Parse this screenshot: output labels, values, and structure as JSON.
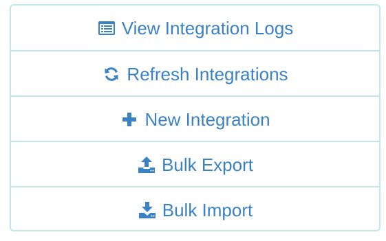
{
  "colors": {
    "accent": "#3b82c4",
    "border": "#bfe7ee",
    "background": "#ffffff"
  },
  "actions": [
    {
      "label": "View Integration Logs",
      "icon": "list-alt-icon"
    },
    {
      "label": "Refresh Integrations",
      "icon": "refresh-icon"
    },
    {
      "label": "New Integration",
      "icon": "plus-icon"
    },
    {
      "label": "Bulk Export",
      "icon": "upload-icon"
    },
    {
      "label": "Bulk Import",
      "icon": "download-icon"
    }
  ]
}
